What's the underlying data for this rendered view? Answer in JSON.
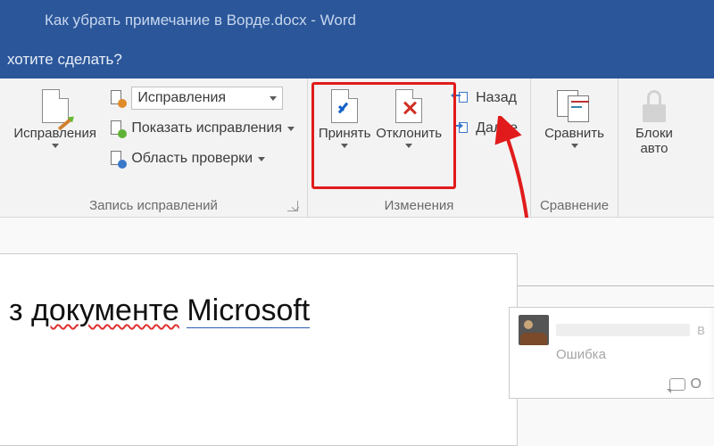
{
  "titlebar": {
    "title": "Как убрать примечание в Ворде.docx - Word"
  },
  "tellme": {
    "prompt": "хотите сделать?"
  },
  "ribbon": {
    "tracking": {
      "big_label": "Исправления",
      "display_combo": "Исправления",
      "show_markup": "Показать исправления",
      "reviewing_pane": "Область проверки",
      "group_label": "Запись исправлений"
    },
    "changes": {
      "accept": "Принять",
      "reject": "Отклонить",
      "previous": "Назад",
      "next": "Далее",
      "group_label": "Изменения"
    },
    "compare": {
      "compare": "Сравнить",
      "group_label": "Сравнение"
    },
    "protect": {
      "block_authors_l1": "Блоки",
      "block_authors_l2": "авто"
    }
  },
  "document": {
    "text_prefix": "з ",
    "text_word1": "документе",
    "text_word2": "Microsoft"
  },
  "comment": {
    "author_placeholder": "",
    "status": "Ошибка",
    "reply": "О"
  }
}
